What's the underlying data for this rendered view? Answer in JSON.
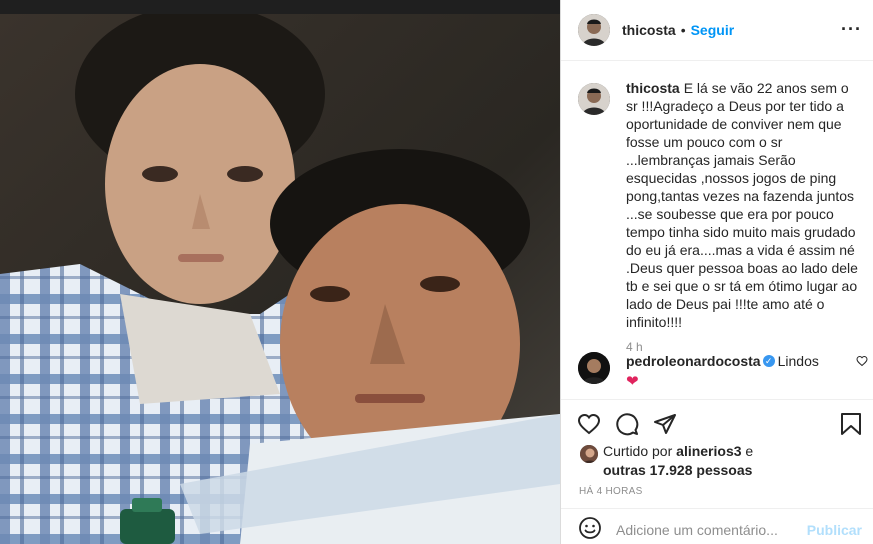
{
  "post": {
    "author": "thicosta",
    "dot": "•",
    "follow_label": "Seguir",
    "more_label": "···",
    "caption": "E lá se vão 22 anos sem o sr !!!Agradeço a Deus por ter tido a oportunidade de conviver nem que fosse um pouco com o sr ...lembranças jamais Serão esquecidas ,nossos jogos de ping pong,tantas vezes na fazenda juntos ...se soubesse que era por pouco tempo tinha sido muito mais grudado do eu já era....mas a vida é assim né .Deus quer pessoa boas ao lado dele tb e sei que o sr tá em ótimo lugar ao lado de Deus pai !!!te amo até o infinito!!!!",
    "caption_time": "4 h"
  },
  "comment": {
    "username": "pedroleonardocosta",
    "verified_mark": "✓",
    "text": "Lindos",
    "emoji": "❤"
  },
  "likes": {
    "prefix": "Curtido por",
    "liker": "alinerios3",
    "suffix": "e",
    "others": "outras 17.928 pessoas"
  },
  "date_label": "HÁ 4 HORAS",
  "add_comment": {
    "placeholder": "Adicione um comentário...",
    "post_label": "Publicar"
  },
  "colors": {
    "link": "#0095f6",
    "verified": "#3897f0",
    "muted": "#8e8e8e",
    "publish_disabled": "#b2dffc",
    "heart": "#e0245e"
  },
  "icons": {
    "like": "heart-outline-icon",
    "comment": "comment-bubble-icon",
    "share": "paper-plane-icon",
    "save": "bookmark-icon",
    "add_comment": "smiley-icon"
  }
}
